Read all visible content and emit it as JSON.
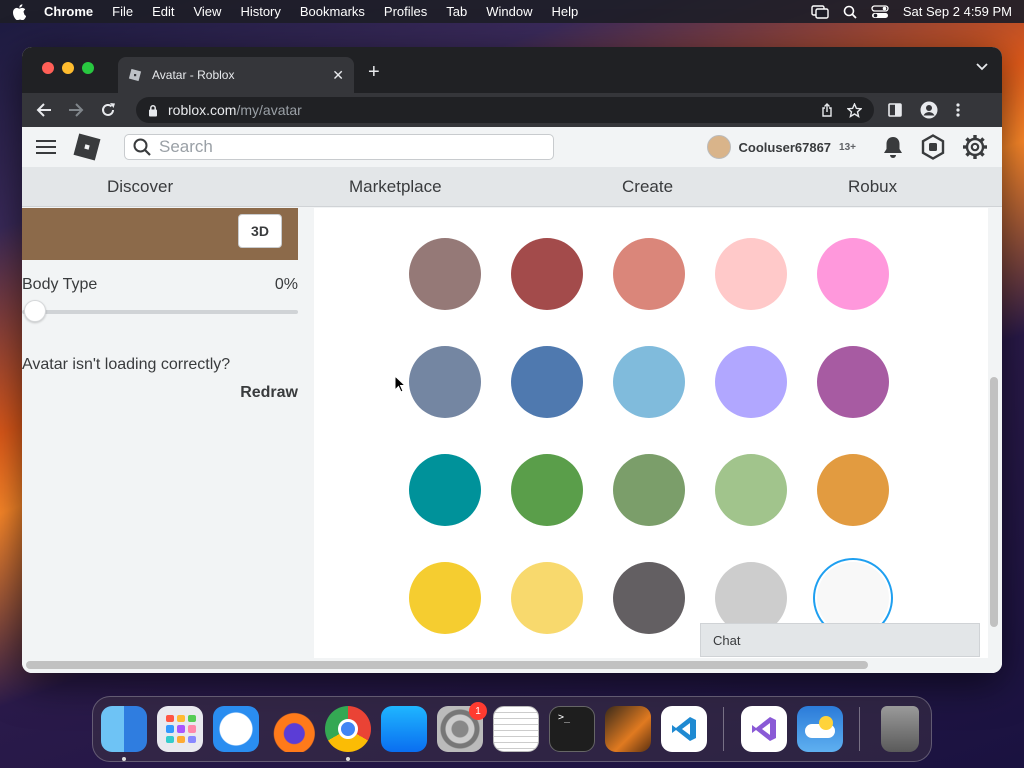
{
  "menubar": {
    "app": "Chrome",
    "items": [
      "File",
      "Edit",
      "View",
      "History",
      "Bookmarks",
      "Profiles",
      "Tab",
      "Window",
      "Help"
    ],
    "datetime": "Sat Sep 2  4:59 PM"
  },
  "browser": {
    "tab_title": "Avatar - Roblox",
    "url_host": "roblox.com",
    "url_path": "/my/avatar"
  },
  "header": {
    "search_placeholder": "Search",
    "username": "Cooluser67867",
    "age_badge": "13+"
  },
  "nav": {
    "items": [
      "Discover",
      "Marketplace",
      "Create",
      "Robux"
    ]
  },
  "left": {
    "btn_3d": "3D",
    "body_type_label": "Body Type",
    "body_type_value": "0%",
    "body_type_fraction": 0.0,
    "loading_msg": "Avatar isn't loading correctly?",
    "redraw": "Redraw"
  },
  "swatches": {
    "colors": [
      [
        "#957977",
        "#a34b4b",
        "#da867a",
        "#ffc9c9",
        "#ff98dc"
      ],
      [
        "#7486a2",
        "#4f79af",
        "#80bbdc",
        "#b1a7ff",
        "#a75ba2"
      ],
      [
        "#00929a",
        "#5a9e4a",
        "#7b9e6a",
        "#a1c48c",
        "#e29b40"
      ],
      [
        "#f5cd30",
        "#f8d96d",
        "#635f62",
        "#cdcdcd",
        "#f8f8f8"
      ]
    ],
    "selected": "#f8f8f8",
    "accent": "#1e9ff0"
  },
  "chat": {
    "label": "Chat"
  },
  "dock": {
    "apps": [
      "finder-icon",
      "launchpad-icon",
      "safari-icon",
      "firefox-icon",
      "chrome-icon",
      "app-store-icon",
      "system-settings-icon",
      "textedit-icon",
      "terminal-icon",
      "garageband-icon",
      "vscode-icon",
      "visual-studio-icon",
      "weather-icon",
      "trash-icon"
    ],
    "settings_badge": "1"
  }
}
